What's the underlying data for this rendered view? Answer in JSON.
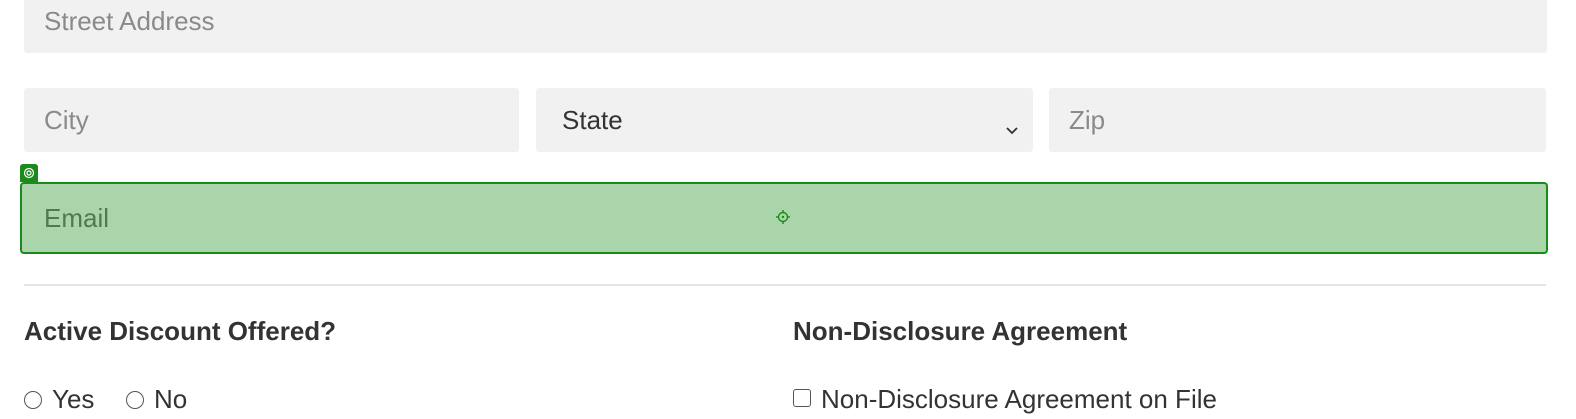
{
  "address": {
    "street_placeholder": "Street Address",
    "city_placeholder": "City",
    "state_selected": "State",
    "zip_placeholder": "Zip"
  },
  "contact": {
    "email_placeholder": "Email",
    "focus_color": "#1a8a1a",
    "highlight_color": "#aad5ab"
  },
  "discount": {
    "heading": "Active Discount Offered?",
    "options": [
      "Yes",
      "No"
    ]
  },
  "nda": {
    "heading": "Non-Disclosure Agreement",
    "checkbox_label": "Non-Disclosure Agreement on File"
  }
}
